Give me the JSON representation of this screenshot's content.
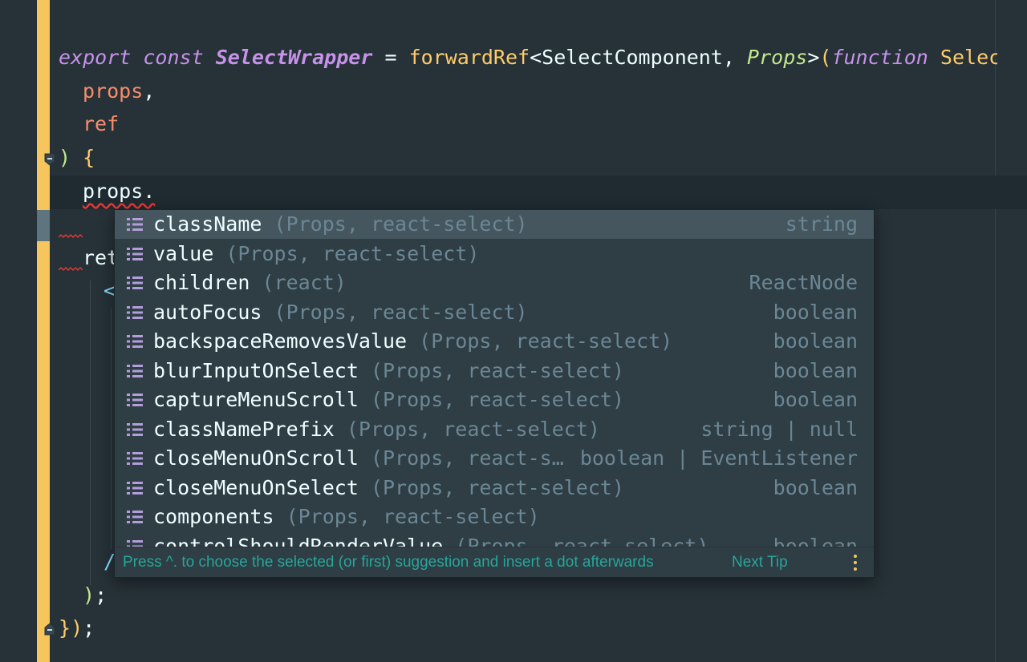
{
  "editor": {
    "lines": {
      "l1": {
        "export": "export",
        "const": "const",
        "name": "SelectWrapper",
        "eq": "=",
        "forwardRef": "forwardRef",
        "lt": "<",
        "component": "SelectComponent",
        "comma": ",",
        "props_type": "Props",
        "gt": ">",
        "open": "(",
        "function": "function",
        "select": "Select",
        "open2": "("
      },
      "l2": {
        "text": "props",
        "comma": ","
      },
      "l3": {
        "text": "ref"
      },
      "l4": {
        "close": ")",
        "brace": "{"
      },
      "l5": {
        "text": "props."
      },
      "l6": {
        "text": "ret"
      },
      "l7": {
        "text": "<"
      },
      "l8": {
        "text": "/"
      },
      "l9": {
        "text": ")",
        "semi": ";"
      },
      "l10": {
        "brace": "}",
        "paren": ")",
        "semi": ";"
      }
    }
  },
  "completion": {
    "items": [
      {
        "name": "className",
        "context": "(Props, react-select)",
        "type": "string"
      },
      {
        "name": "value",
        "context": "(Props, react-select)",
        "type": ""
      },
      {
        "name": "children",
        "context": "(react)",
        "type": "ReactNode"
      },
      {
        "name": "autoFocus",
        "context": "(Props, react-select)",
        "type": "boolean"
      },
      {
        "name": "backspaceRemovesValue",
        "context": "(Props, react-select)",
        "type": "boolean"
      },
      {
        "name": "blurInputOnSelect",
        "context": "(Props, react-select)",
        "type": "boolean"
      },
      {
        "name": "captureMenuScroll",
        "context": "(Props, react-select)",
        "type": "boolean"
      },
      {
        "name": "classNamePrefix",
        "context": "(Props, react-select)",
        "type": "string | null"
      },
      {
        "name": "closeMenuOnScroll",
        "context": "(Props, react-s…",
        "type": "boolean | EventListener"
      },
      {
        "name": "closeMenuOnSelect",
        "context": "(Props, react-select)",
        "type": "boolean"
      },
      {
        "name": "components",
        "context": "(Props, react-select)",
        "type": ""
      },
      {
        "name": "controlShouldRenderValue",
        "context": "(Props, react-select)",
        "type": "boolean"
      }
    ],
    "selected_index": 0,
    "icon": "property-list-icon",
    "tip": "Press ^. to choose the selected (or first) suggestion and insert a dot afterwards",
    "next_tip": "Next Tip"
  },
  "colors": {
    "background": "#263238",
    "change_marker": "#f7c55d",
    "keyword": "#c792ea",
    "function": "#ffcb6b",
    "type": "#c3e88d",
    "parameter": "#f78c6c",
    "tip": "#26a69a"
  }
}
